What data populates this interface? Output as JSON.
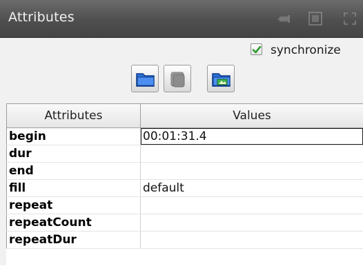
{
  "panel": {
    "title": "Attributes",
    "title_icons": [
      "pin-icon",
      "restore-window-icon",
      "maximize-icon"
    ]
  },
  "sync": {
    "label": "synchronize",
    "checked": true,
    "check_color": "#2e9a2e"
  },
  "toolbar": {
    "buttons": [
      {
        "icon": "folder-open-icon",
        "enabled": true
      },
      {
        "icon": "document-stack-icon",
        "enabled": false
      },
      {
        "icon": "folder-image-icon",
        "enabled": true
      }
    ]
  },
  "table": {
    "headers": [
      "Attributes",
      "Values"
    ],
    "rows": [
      {
        "name": "begin",
        "value": "00:01:31.4"
      },
      {
        "name": "dur",
        "value": ""
      },
      {
        "name": "end",
        "value": ""
      },
      {
        "name": "fill",
        "value": "default"
      },
      {
        "name": "repeat",
        "value": ""
      },
      {
        "name": "repeatCount",
        "value": ""
      },
      {
        "name": "repeatDur",
        "value": ""
      }
    ]
  },
  "colors": {
    "titlebar": "#555555",
    "accent_blue": "#1f5fc4"
  }
}
